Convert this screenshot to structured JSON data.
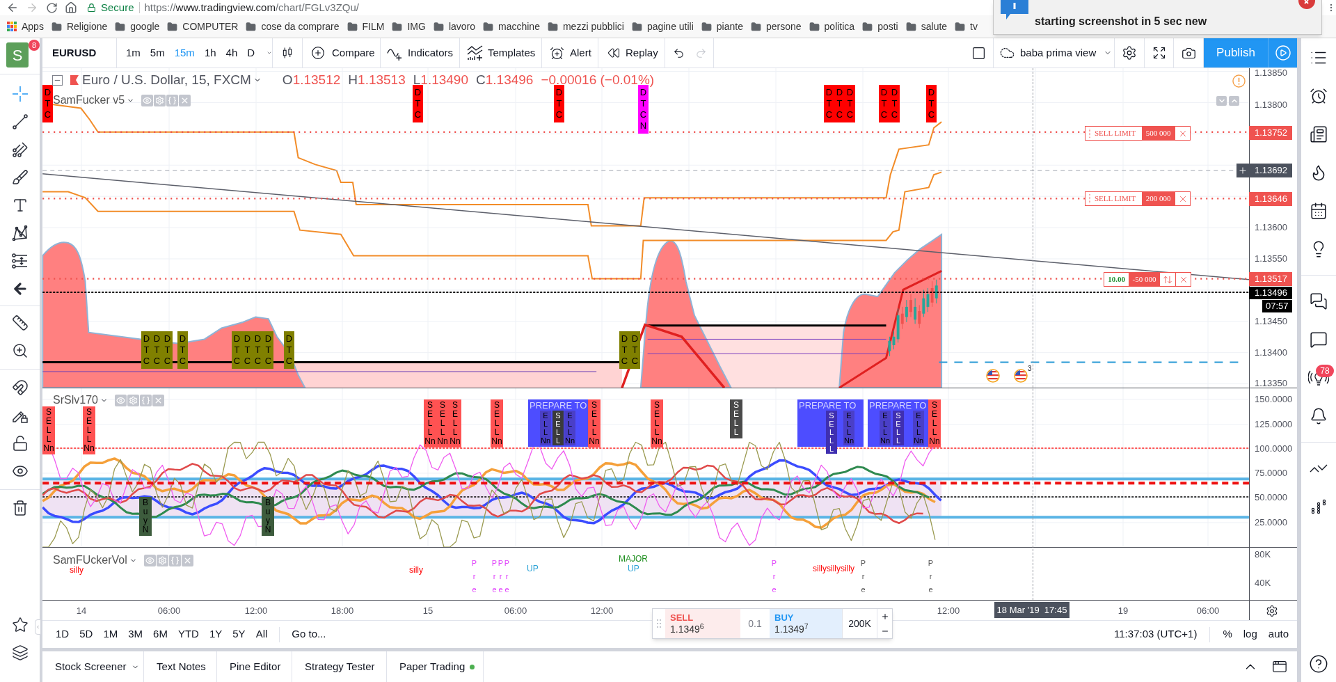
{
  "browser": {
    "secure_label": "Secure",
    "url": {
      "scheme": "https://",
      "host": "www.tradingview.com",
      "path": "/chart/FGLv3ZQu/"
    },
    "bookmarks": [
      {
        "kind": "apps",
        "label": "Apps"
      },
      {
        "kind": "folder",
        "label": "Religione"
      },
      {
        "kind": "folder",
        "label": "google"
      },
      {
        "kind": "folder",
        "label": "COMPUTER"
      },
      {
        "kind": "folder",
        "label": "cose da comprare"
      },
      {
        "kind": "folder",
        "label": "FILM"
      },
      {
        "kind": "folder",
        "label": "IMG"
      },
      {
        "kind": "folder",
        "label": "lavoro"
      },
      {
        "kind": "folder",
        "label": "macchine"
      },
      {
        "kind": "folder",
        "label": "mezzi pubblici"
      },
      {
        "kind": "folder",
        "label": "pagine utili"
      },
      {
        "kind": "folder",
        "label": "piante"
      },
      {
        "kind": "folder",
        "label": "persone"
      },
      {
        "kind": "folder",
        "label": "politica"
      },
      {
        "kind": "folder",
        "label": "posti"
      },
      {
        "kind": "folder",
        "label": "salute"
      },
      {
        "kind": "folder",
        "label": "tv"
      }
    ]
  },
  "notification": {
    "text": "starting screenshot in 5 sec new"
  },
  "account": {
    "initial": "S",
    "badge": "8"
  },
  "drawing_tools": [
    {
      "selected": true
    },
    {
      "selected": false
    },
    {
      "selected": false
    },
    {
      "selected": false
    },
    {
      "selected": false
    },
    {
      "selected": false
    },
    {
      "selected": false
    },
    {
      "selected": false
    },
    {
      "selected": false
    },
    {
      "selected": false
    },
    {
      "selected": false
    },
    {
      "selected": false
    },
    {
      "selected": false
    },
    {
      "selected": false
    },
    {
      "selected": false
    }
  ],
  "toolbar": {
    "symbol": "EURUSD",
    "intervals": [
      {
        "label": "1m",
        "selected": false
      },
      {
        "label": "5m",
        "selected": false
      },
      {
        "label": "15m",
        "selected": true
      },
      {
        "label": "1h",
        "selected": false
      },
      {
        "label": "4h",
        "selected": false
      },
      {
        "label": "D",
        "selected": false
      }
    ],
    "actions": [
      "Compare",
      "Indicators",
      "Templates",
      "Alert",
      "Replay"
    ],
    "layout_name": "baba prima view",
    "publish": "Publish"
  },
  "main_pane": {
    "title": "Euro / U.S. Dollar, 15, FXCM",
    "ohlc": [
      {
        "key": "O",
        "value": "1.13512"
      },
      {
        "key": "H",
        "value": "1.13513"
      },
      {
        "key": "L",
        "value": "1.13490"
      },
      {
        "key": "C",
        "value": "1.13496"
      }
    ],
    "change": "−0.00016 (−0.01%)",
    "indicator": "SamFucker v5",
    "price_ticks": [
      "1.13850",
      "1.13800",
      "1.13600",
      "1.13550",
      "1.13450",
      "1.13400",
      "1.13350"
    ],
    "price_labels": [
      {
        "kind": "order",
        "text": "1.13752"
      },
      {
        "kind": "crosshair",
        "text": "1.13692"
      },
      {
        "kind": "order",
        "text": "1.13646"
      },
      {
        "kind": "order",
        "text": "1.13517"
      },
      {
        "kind": "last",
        "text": "1.13496"
      },
      {
        "kind": "countdown",
        "text": "07:57"
      }
    ],
    "orders": [
      {
        "kind": "limit",
        "label": "SELL LIMIT",
        "quantity": "500 000"
      },
      {
        "kind": "limit",
        "label": "SELL LIMIT",
        "quantity": "200 000"
      },
      {
        "kind": "position",
        "label": "10.00",
        "quantity": "-50 000"
      }
    ],
    "markers": [
      {
        "lines": [
          "D",
          "T",
          "C"
        ],
        "color": "#ff0000"
      },
      {
        "lines": [
          "D",
          "T",
          "C"
        ],
        "color": "#ff0000"
      },
      {
        "lines": [
          "D",
          "T",
          "C"
        ],
        "color": "#ff0000"
      },
      {
        "lines": [
          "D",
          "T",
          "C",
          "N"
        ],
        "color": "#ff00ff"
      },
      {
        "lines": [
          "D",
          "T",
          "C"
        ],
        "color": "#ff0000"
      },
      {
        "lines": [
          "D",
          "T",
          "C"
        ],
        "color": "#ff0000"
      },
      {
        "lines": [
          "D",
          "T",
          "C"
        ],
        "color": "#ff0000"
      },
      {
        "lines": [
          "D",
          "T",
          "C"
        ],
        "color": "#ff0000"
      },
      {
        "lines": [
          "D",
          "T",
          "C"
        ],
        "color": "#ff0000"
      },
      {
        "lines": [
          "D",
          "T",
          "C"
        ],
        "color": "#ff0000"
      },
      {
        "lines": [
          "D",
          "T",
          "C"
        ],
        "color": "#808000"
      },
      {
        "lines": [
          "D",
          "T",
          "C"
        ],
        "color": "#808000"
      },
      {
        "lines": [
          "D",
          "T",
          "C"
        ],
        "color": "#808000"
      },
      {
        "lines": [
          "D",
          "T",
          "C"
        ],
        "color": "#808000"
      },
      {
        "lines": [
          "D",
          "T",
          "C"
        ],
        "color": "#808000"
      },
      {
        "lines": [
          "D",
          "T",
          "C"
        ],
        "color": "#808000"
      },
      {
        "lines": [
          "D",
          "T",
          "C"
        ],
        "color": "#808000"
      },
      {
        "lines": [
          "D",
          "T",
          "C"
        ],
        "color": "#808000"
      },
      {
        "lines": [
          "D",
          "T",
          "C"
        ],
        "color": "#808000"
      },
      {
        "lines": [
          "D",
          "T",
          "C"
        ],
        "color": "#808000"
      },
      {
        "lines": [
          "D",
          "T",
          "C"
        ],
        "color": "#808000"
      }
    ],
    "events": [
      {
        "kind": "flag"
      },
      {
        "kind": "flag",
        "badge": "3"
      }
    ]
  },
  "oscillator_pane": {
    "indicator": "SrSlv170",
    "ticks": [
      "150.0000",
      "125.0000",
      "100.0000",
      "75.0000",
      "50.0000",
      "25.0000"
    ],
    "markers": [
      {
        "kind": "signal",
        "lines": [
          "S",
          "E",
          "L",
          "L",
          "Nn"
        ],
        "color": "#ff5252"
      },
      {
        "kind": "signal",
        "lines": [
          "S",
          "E",
          "L",
          "L",
          "Nn"
        ],
        "color": "#ff5252"
      },
      {
        "kind": "signal",
        "lines": [
          "S",
          "E",
          "L",
          "L",
          "Nn"
        ],
        "color": "#ff5252"
      },
      {
        "kind": "signal",
        "lines": [
          "S",
          "E",
          "L",
          "L",
          "Nn"
        ],
        "color": "#ff5252"
      },
      {
        "kind": "signal",
        "lines": [
          "S",
          "E",
          "L",
          "L",
          "Nn"
        ],
        "color": "#ff5252"
      },
      {
        "kind": "signal",
        "lines": [
          "S",
          "E",
          "L",
          "L",
          "Nn"
        ],
        "color": "#ff5252"
      },
      {
        "kind": "prepare",
        "label": "PREPARE TO",
        "color": "#4d4dff",
        "inner": [
          {
            "lines": [
              "E",
              "L",
              "L",
              "Nn"
            ],
            "color": "#4a3fc8"
          },
          {
            "lines": [
              "S",
              "E",
              "L",
              "L"
            ],
            "color": "#3a3a3a"
          },
          {
            "lines": [
              "E",
              "L",
              "L",
              "Nn"
            ],
            "color": "#4a3fc8"
          }
        ]
      },
      {
        "kind": "signal",
        "lines": [
          "S",
          "E",
          "L",
          "L",
          "Nn"
        ],
        "color": "#ff5252"
      },
      {
        "kind": "signal",
        "lines": [
          "S",
          "E",
          "L",
          "L",
          "Nn"
        ],
        "color": "#ff5252"
      },
      {
        "kind": "signal",
        "lines": [
          "S",
          "E",
          "L",
          "L"
        ],
        "color": "#4a4a4a"
      },
      {
        "kind": "prepare",
        "label": "PREPARE TO",
        "color": "#4d4dff",
        "inner": [
          {
            "lines": [
              "S",
              "E",
              "L",
              "L",
              "L"
            ],
            "color": "#3f2fb0"
          },
          {
            "lines": [
              "E",
              "L",
              "L",
              "Nn"
            ],
            "color": "#4a3fc8"
          }
        ]
      },
      {
        "kind": "prepare",
        "label": "PREPARE TO",
        "color": "#4d4dff",
        "inner": [
          {
            "lines": [
              "E",
              "L",
              "L",
              "Nn"
            ],
            "color": "#4a3fc8"
          },
          {
            "lines": [
              "S",
              "E",
              "L",
              "L"
            ],
            "color": "#3f2fb0"
          },
          {
            "lines": [
              "E",
              "L",
              "L",
              "Nn"
            ],
            "color": "#4a3fc8"
          }
        ]
      },
      {
        "kind": "signal",
        "lines": [
          "S",
          "E",
          "L",
          "L",
          "Nn"
        ],
        "color": "#ff5252"
      },
      {
        "kind": "signal",
        "lines": [
          "B",
          "u",
          "y",
          "N"
        ],
        "color": "#3d5c3d"
      },
      {
        "kind": "signal",
        "lines": [
          "B",
          "u",
          "y",
          "N"
        ],
        "color": "#3d5c3d"
      }
    ]
  },
  "volume_pane": {
    "indicator": "SamFUckerVol",
    "ticks": [
      "80K",
      "40K"
    ],
    "markers": [
      {
        "lines": [
          "silly"
        ],
        "color": "#ff0000"
      },
      {
        "lines": [
          "silly"
        ],
        "color": "#ff0000"
      },
      {
        "lines": [
          "P",
          "r",
          "e"
        ],
        "color": "#e040fb"
      },
      {
        "lines": [
          "P",
          "r",
          "e"
        ],
        "color": "#e040fb"
      },
      {
        "lines": [
          "P",
          "r",
          "e"
        ],
        "color": "#e040fb"
      },
      {
        "lines": [
          "P",
          "r",
          "e"
        ],
        "color": "#e040fb"
      },
      {
        "lines": [
          "UP"
        ],
        "color": "#2aa2d6"
      },
      {
        "lines": [
          "MAJOR"
        ],
        "color": "#1f8f1f"
      },
      {
        "lines": [
          "UP"
        ],
        "color": "#2aa2d6"
      },
      {
        "lines": [
          "P",
          "r",
          "e"
        ],
        "color": "#e040fb"
      },
      {
        "lines": [
          "sillysillysilly"
        ],
        "color": "#ff0000"
      },
      {
        "lines": [
          "P",
          "r",
          "e"
        ],
        "color": "#555555"
      },
      {
        "lines": [
          "P",
          "r",
          "e"
        ],
        "color": "#555555"
      }
    ]
  },
  "time_axis": {
    "ticks": [
      "14",
      "06:00",
      "12:00",
      "18:00",
      "15",
      "06:00",
      "12:00",
      "12:00",
      "19",
      "06:00"
    ],
    "crosshair_label": "18 Mar '19  17:45"
  },
  "trade_panel": {
    "sell_label": "SELL",
    "sell_price": "1.1349$^{6}$",
    "spread": "0.1",
    "buy_label": "BUY",
    "buy_price": "1.1349$^{7}$",
    "quantity": "200K"
  },
  "range_bar": {
    "ranges": [
      "1D",
      "5D",
      "1M",
      "3M",
      "6M",
      "YTD",
      "1Y",
      "5Y",
      "All"
    ],
    "goto": "Go to...",
    "clock": "11:37:03 (UTC+1)",
    "scale_options": [
      "%",
      "log",
      "auto"
    ]
  },
  "bottom_tabs": [
    {
      "label": "Stock Screener",
      "kind": "dropdown",
      "connected": false
    },
    {
      "label": "Text Notes",
      "kind": "plain",
      "connected": false
    },
    {
      "label": "Pine Editor",
      "kind": "plain",
      "connected": false
    },
    {
      "label": "Strategy Tester",
      "kind": "plain",
      "connected": false
    },
    {
      "label": "Paper Trading",
      "kind": "plain",
      "connected": true
    }
  ],
  "right_sidebar": {
    "ideas_badge": "78"
  }
}
